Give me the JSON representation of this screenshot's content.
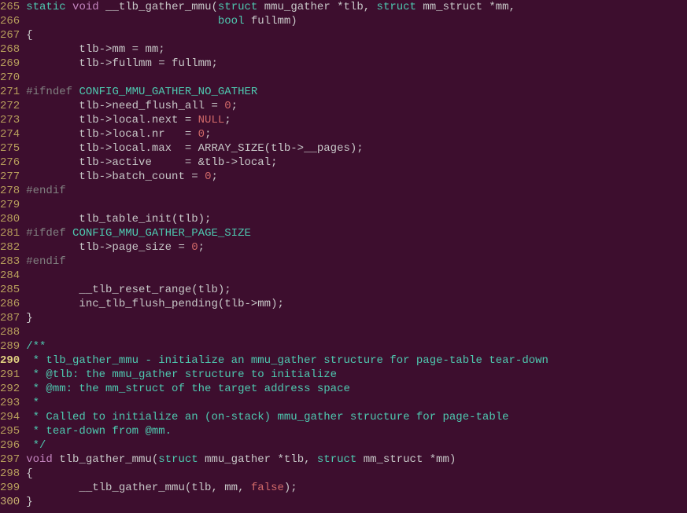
{
  "lines": [
    {
      "num": "265",
      "segments": [
        {
          "cls": "kw-static",
          "text": "static"
        },
        {
          "cls": "text",
          "text": " "
        },
        {
          "cls": "kw-void",
          "text": "void"
        },
        {
          "cls": "text",
          "text": " __tlb_gather_mmu("
        },
        {
          "cls": "kw-struct",
          "text": "struct"
        },
        {
          "cls": "text",
          "text": " mmu_gather *tlb, "
        },
        {
          "cls": "kw-struct",
          "text": "struct"
        },
        {
          "cls": "text",
          "text": " mm_struct *mm,"
        }
      ]
    },
    {
      "num": "266",
      "segments": [
        {
          "cls": "text",
          "text": "                             "
        },
        {
          "cls": "kw-bool",
          "text": "bool"
        },
        {
          "cls": "text",
          "text": " fullmm)"
        }
      ]
    },
    {
      "num": "267",
      "segments": [
        {
          "cls": "text",
          "text": "{"
        }
      ]
    },
    {
      "num": "268",
      "segments": [
        {
          "cls": "text",
          "text": "        tlb->mm = mm;"
        }
      ]
    },
    {
      "num": "269",
      "segments": [
        {
          "cls": "text",
          "text": "        tlb->fullmm = fullmm;"
        }
      ]
    },
    {
      "num": "270",
      "segments": [
        {
          "cls": "text",
          "text": ""
        }
      ]
    },
    {
      "num": "271",
      "segments": [
        {
          "cls": "preprocessor",
          "text": "#ifndef"
        },
        {
          "cls": "text",
          "text": " "
        },
        {
          "cls": "preprocessor-name2",
          "text": "CONFIG_MMU_GATHER_NO_GATHER"
        }
      ]
    },
    {
      "num": "272",
      "segments": [
        {
          "cls": "text",
          "text": "        tlb->need_flush_all = "
        },
        {
          "cls": "kw-zero",
          "text": "0"
        },
        {
          "cls": "text",
          "text": ";"
        }
      ]
    },
    {
      "num": "273",
      "segments": [
        {
          "cls": "text",
          "text": "        tlb->local.next = "
        },
        {
          "cls": "kw-null",
          "text": "NULL"
        },
        {
          "cls": "text",
          "text": ";"
        }
      ]
    },
    {
      "num": "274",
      "segments": [
        {
          "cls": "text",
          "text": "        tlb->local.nr   = "
        },
        {
          "cls": "kw-zero",
          "text": "0"
        },
        {
          "cls": "text",
          "text": ";"
        }
      ]
    },
    {
      "num": "275",
      "segments": [
        {
          "cls": "text",
          "text": "        tlb->local.max  = ARRAY_SIZE(tlb->__pages);"
        }
      ]
    },
    {
      "num": "276",
      "segments": [
        {
          "cls": "text",
          "text": "        tlb->active     = &tlb->local;"
        }
      ]
    },
    {
      "num": "277",
      "segments": [
        {
          "cls": "text",
          "text": "        tlb->batch_count = "
        },
        {
          "cls": "kw-zero",
          "text": "0"
        },
        {
          "cls": "text",
          "text": ";"
        }
      ]
    },
    {
      "num": "278",
      "segments": [
        {
          "cls": "preprocessor",
          "text": "#endif"
        }
      ]
    },
    {
      "num": "279",
      "segments": [
        {
          "cls": "text",
          "text": ""
        }
      ]
    },
    {
      "num": "280",
      "segments": [
        {
          "cls": "text",
          "text": "        tlb_table_init(tlb);"
        }
      ]
    },
    {
      "num": "281",
      "segments": [
        {
          "cls": "preprocessor",
          "text": "#ifdef"
        },
        {
          "cls": "text",
          "text": " "
        },
        {
          "cls": "preprocessor-name2",
          "text": "CONFIG_MMU_GATHER_PAGE_SIZE"
        }
      ]
    },
    {
      "num": "282",
      "segments": [
        {
          "cls": "text",
          "text": "        tlb->page_size = "
        },
        {
          "cls": "kw-zero",
          "text": "0"
        },
        {
          "cls": "text",
          "text": ";"
        }
      ]
    },
    {
      "num": "283",
      "segments": [
        {
          "cls": "preprocessor",
          "text": "#endif"
        }
      ]
    },
    {
      "num": "284",
      "segments": [
        {
          "cls": "text",
          "text": ""
        }
      ]
    },
    {
      "num": "285",
      "segments": [
        {
          "cls": "text",
          "text": "        __tlb_reset_range(tlb);"
        }
      ]
    },
    {
      "num": "286",
      "segments": [
        {
          "cls": "text",
          "text": "        inc_tlb_flush_pending(tlb->mm);"
        }
      ]
    },
    {
      "num": "287",
      "segments": [
        {
          "cls": "text",
          "text": "}"
        }
      ]
    },
    {
      "num": "288",
      "segments": [
        {
          "cls": "text",
          "text": ""
        }
      ]
    },
    {
      "num": "289",
      "segments": [
        {
          "cls": "comment-teal",
          "text": "/**"
        }
      ]
    },
    {
      "num": "290",
      "highlight": true,
      "segments": [
        {
          "cls": "comment-teal",
          "text": " * tlb_gather_mmu - initialize an mmu_gather structure for page-table tear-down"
        }
      ]
    },
    {
      "num": "291",
      "segments": [
        {
          "cls": "comment-teal",
          "text": " * @tlb: the mmu_gather structure to initialize"
        }
      ]
    },
    {
      "num": "292",
      "segments": [
        {
          "cls": "comment-teal",
          "text": " * @mm: the mm_struct of the target address space"
        }
      ]
    },
    {
      "num": "293",
      "segments": [
        {
          "cls": "comment-teal",
          "text": " *"
        }
      ]
    },
    {
      "num": "294",
      "segments": [
        {
          "cls": "comment-teal",
          "text": " * Called to initialize an (on-stack) mmu_gather structure for page-table"
        }
      ]
    },
    {
      "num": "295",
      "segments": [
        {
          "cls": "comment-teal",
          "text": " * tear-down from @mm."
        }
      ]
    },
    {
      "num": "296",
      "segments": [
        {
          "cls": "comment-teal",
          "text": " */"
        }
      ]
    },
    {
      "num": "297",
      "segments": [
        {
          "cls": "kw-void",
          "text": "void"
        },
        {
          "cls": "text",
          "text": " tlb_gather_mmu("
        },
        {
          "cls": "kw-struct",
          "text": "struct"
        },
        {
          "cls": "text",
          "text": " mmu_gather *tlb, "
        },
        {
          "cls": "kw-struct",
          "text": "struct"
        },
        {
          "cls": "text",
          "text": " mm_struct *mm)"
        }
      ]
    },
    {
      "num": "298",
      "segments": [
        {
          "cls": "text",
          "text": "{"
        }
      ]
    },
    {
      "num": "299",
      "segments": [
        {
          "cls": "text",
          "text": "        __tlb_gather_mmu(tlb, mm, "
        },
        {
          "cls": "kw-false",
          "text": "false"
        },
        {
          "cls": "text",
          "text": ");"
        }
      ]
    },
    {
      "num": "300",
      "highlight2": true,
      "segments": [
        {
          "cls": "text",
          "text": "}"
        }
      ]
    }
  ]
}
